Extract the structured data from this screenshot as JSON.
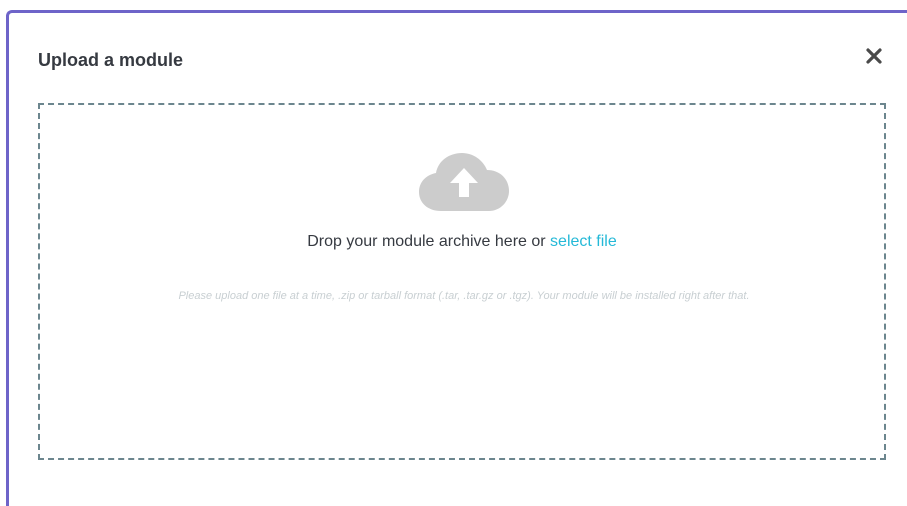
{
  "modal": {
    "title": "Upload a module",
    "close_icon": "close-icon"
  },
  "dropzone": {
    "icon": "cloud-upload-icon",
    "drop_text": "Drop your module archive here or",
    "select_file_link": "select file",
    "help_text": "Please upload one file at a time, .zip or tarball format (.tar, .tar.gz or .tgz). Your module will be installed right after that."
  },
  "colors": {
    "accent_border": "#6e64c9",
    "link": "#25b9d7",
    "icon_gray": "#cccccc",
    "title_text": "#363a41",
    "help_text": "#c8cfd2"
  }
}
